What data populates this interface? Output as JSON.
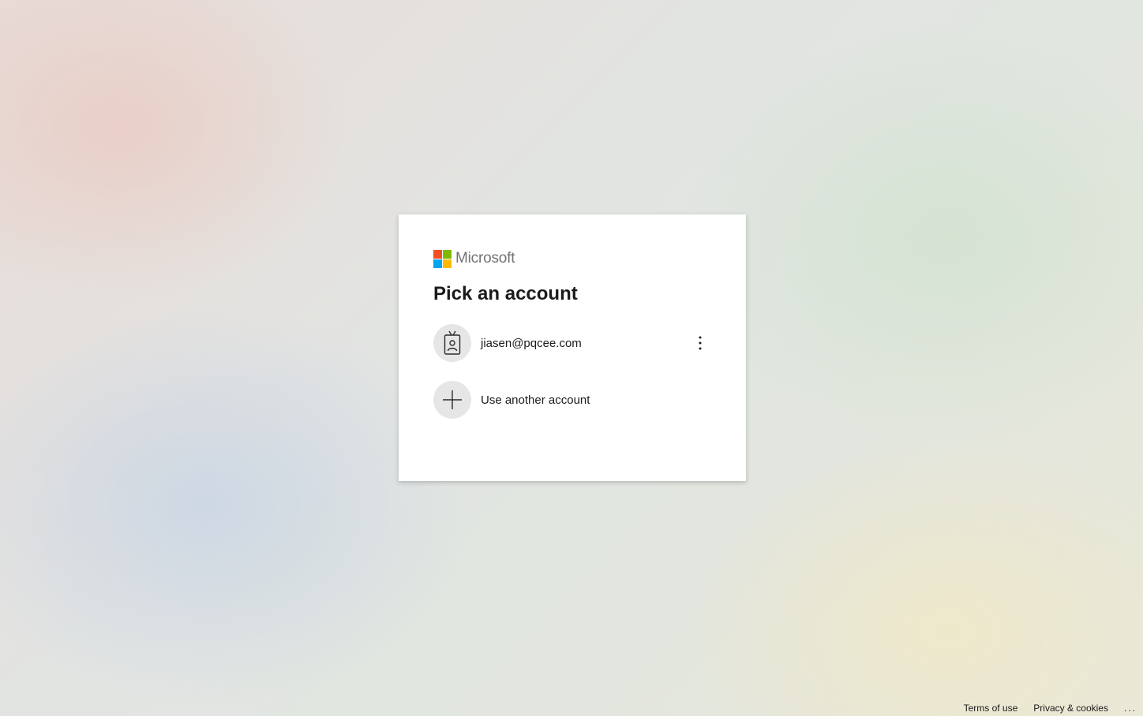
{
  "brand": {
    "name": "Microsoft",
    "logo_colors": [
      "#f25022",
      "#7fba00",
      "#00a4ef",
      "#ffb900"
    ]
  },
  "page": {
    "title": "Pick an account"
  },
  "accounts": [
    {
      "email": "jiasen@pqcee.com",
      "icon": "badge-person-icon",
      "more_icon": "more-options-vertical-icon"
    }
  ],
  "other_account": {
    "label": "Use another account",
    "icon": "plus-icon"
  },
  "footer": {
    "terms": "Terms of use",
    "privacy": "Privacy & cookies",
    "more": "..."
  }
}
